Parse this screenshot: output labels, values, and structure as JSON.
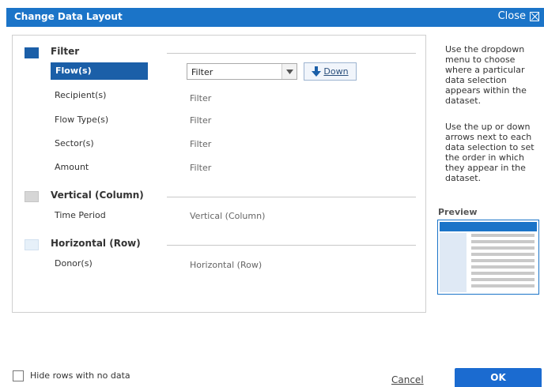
{
  "dialog": {
    "title": "Change Data Layout",
    "close_label": "Close"
  },
  "sections": {
    "filter": {
      "label": "Filter",
      "color": "#1b5fa8",
      "selected_item": "Flow(s)",
      "dropdown_value": "Filter",
      "down_label": "Down",
      "items": [
        {
          "label": "Recipient(s)",
          "value": "Filter"
        },
        {
          "label": "Flow Type(s)",
          "value": "Filter"
        },
        {
          "label": "Sector(s)",
          "value": "Filter"
        },
        {
          "label": "Amount",
          "value": "Filter"
        }
      ]
    },
    "vertical": {
      "label": "Vertical (Column)",
      "color": "#d6d6d6",
      "items": [
        {
          "label": "Time Period",
          "value": "Vertical (Column)"
        }
      ]
    },
    "horizontal": {
      "label": "Horizontal (Row)",
      "color": "#e6f0f9",
      "items": [
        {
          "label": "Donor(s)",
          "value": "Horizontal (Row)"
        }
      ]
    }
  },
  "help": {
    "text1": "Use the dropdown menu to choose where a particular data selection appears within the dataset.",
    "text2": "Use the up or down arrows next to each data selection to set the order in which they appear in the dataset."
  },
  "preview": {
    "label": "Preview"
  },
  "footer": {
    "hide_rows_label": "Hide rows with no data",
    "hide_rows_checked": false,
    "cancel_label": "Cancel",
    "ok_label": "OK"
  },
  "icons": {
    "close": "close-icon",
    "dropdown": "chevron-down-icon",
    "down_arrow": "arrow-down-icon"
  }
}
